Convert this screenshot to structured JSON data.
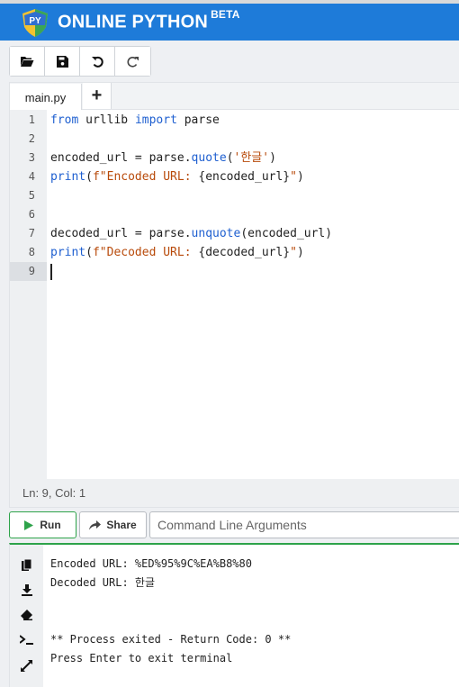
{
  "header": {
    "brand": "ONLINE PYTHON",
    "beta": "BETA",
    "logo_text": "PY",
    "colors": {
      "bar": "#1e7bd9",
      "logo_blue": "#2f6fd1",
      "logo_yellow": "#f2c230",
      "logo_green": "#3aa655"
    }
  },
  "toolbar": {
    "buttons": [
      "open-folder-icon",
      "save-icon",
      "undo-icon",
      "redo-icon"
    ]
  },
  "tabs": {
    "active": "main.py",
    "add_label": "+"
  },
  "editor": {
    "line_numbers": [
      "1",
      "2",
      "3",
      "4",
      "5",
      "6",
      "7",
      "8",
      "9"
    ],
    "active_line": 9,
    "status": "Ln: 9,  Col: 1"
  },
  "runbar": {
    "run_label": "Run",
    "share_label": "Share",
    "args_placeholder": "Command Line Arguments",
    "accent": "#2ea34a"
  },
  "terminal": {
    "side_icons": [
      "copy-icon",
      "download-icon",
      "eraser-icon",
      "prompt-icon",
      "expand-icon"
    ],
    "lines": [
      "Encoded URL: %ED%95%9C%EA%B8%80",
      "Decoded URL: 한글",
      "",
      "",
      "** Process exited - Return Code: 0 **",
      "Press Enter to exit terminal"
    ]
  }
}
